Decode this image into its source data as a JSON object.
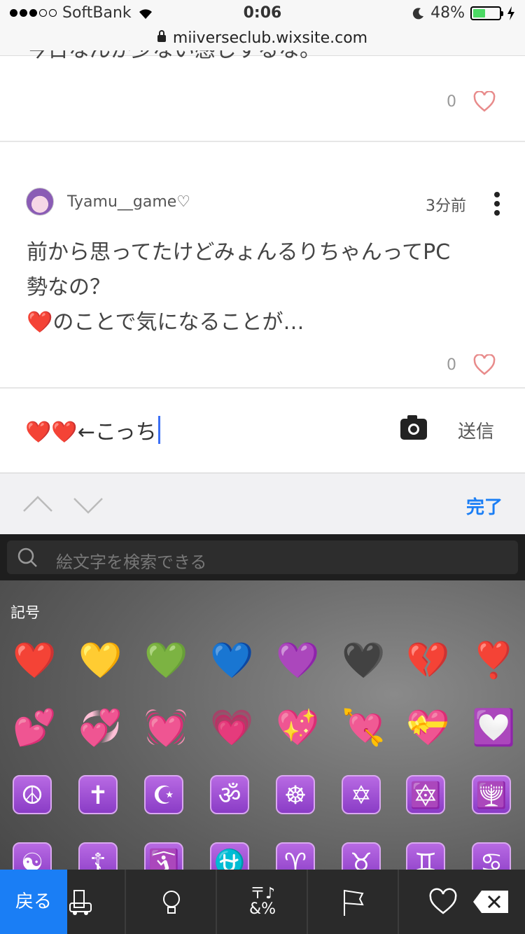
{
  "status": {
    "carrier": "SoftBank",
    "time": "0:06",
    "battery": "48%",
    "battery_level": 0.48
  },
  "browser": {
    "url": "miiverseclub.wixsite.com"
  },
  "feed": {
    "prev_post": {
      "text_partial": "今日なんか少ない感じするな。",
      "likes": "0"
    },
    "post": {
      "username": "Tyamu__game♡",
      "time_ago": "3分前",
      "body_line1": "前から思ってたけどみょんるりちゃんってPC",
      "body_line2": "勢なの？",
      "body_line3_emoji": "❤️",
      "body_line3_text": "のことで気になることが…",
      "likes": "0"
    }
  },
  "compose": {
    "value": "❤️❤️←こっち",
    "send_label": "送信"
  },
  "accessory": {
    "done_label": "完了"
  },
  "keyboard": {
    "search_placeholder": "絵文字を検索できる",
    "category_label": "記号",
    "back_label": "戻る",
    "symbols_tab": "〒♪\n&%",
    "row1": [
      "❤️",
      "💛",
      "💚",
      "💙",
      "💜",
      "🖤",
      "💔",
      "❣️"
    ],
    "row2": [
      "💕",
      "💞",
      "💓",
      "💗",
      "💖",
      "💘",
      "💝",
      "💟"
    ],
    "row3": [
      "☮",
      "✝",
      "☪",
      "ॐ",
      "☸",
      "✡",
      "🔯",
      "🕎"
    ],
    "row4": [
      "☯",
      "☦",
      "🛐",
      "⛎",
      "♈",
      "♉",
      "♊",
      "♋"
    ]
  },
  "colors": {
    "accent_blue": "#1a7ef5",
    "heart_outline": "#e88b8b",
    "caret": "#3b6ff5",
    "symbol_tile": "#a055d6"
  }
}
